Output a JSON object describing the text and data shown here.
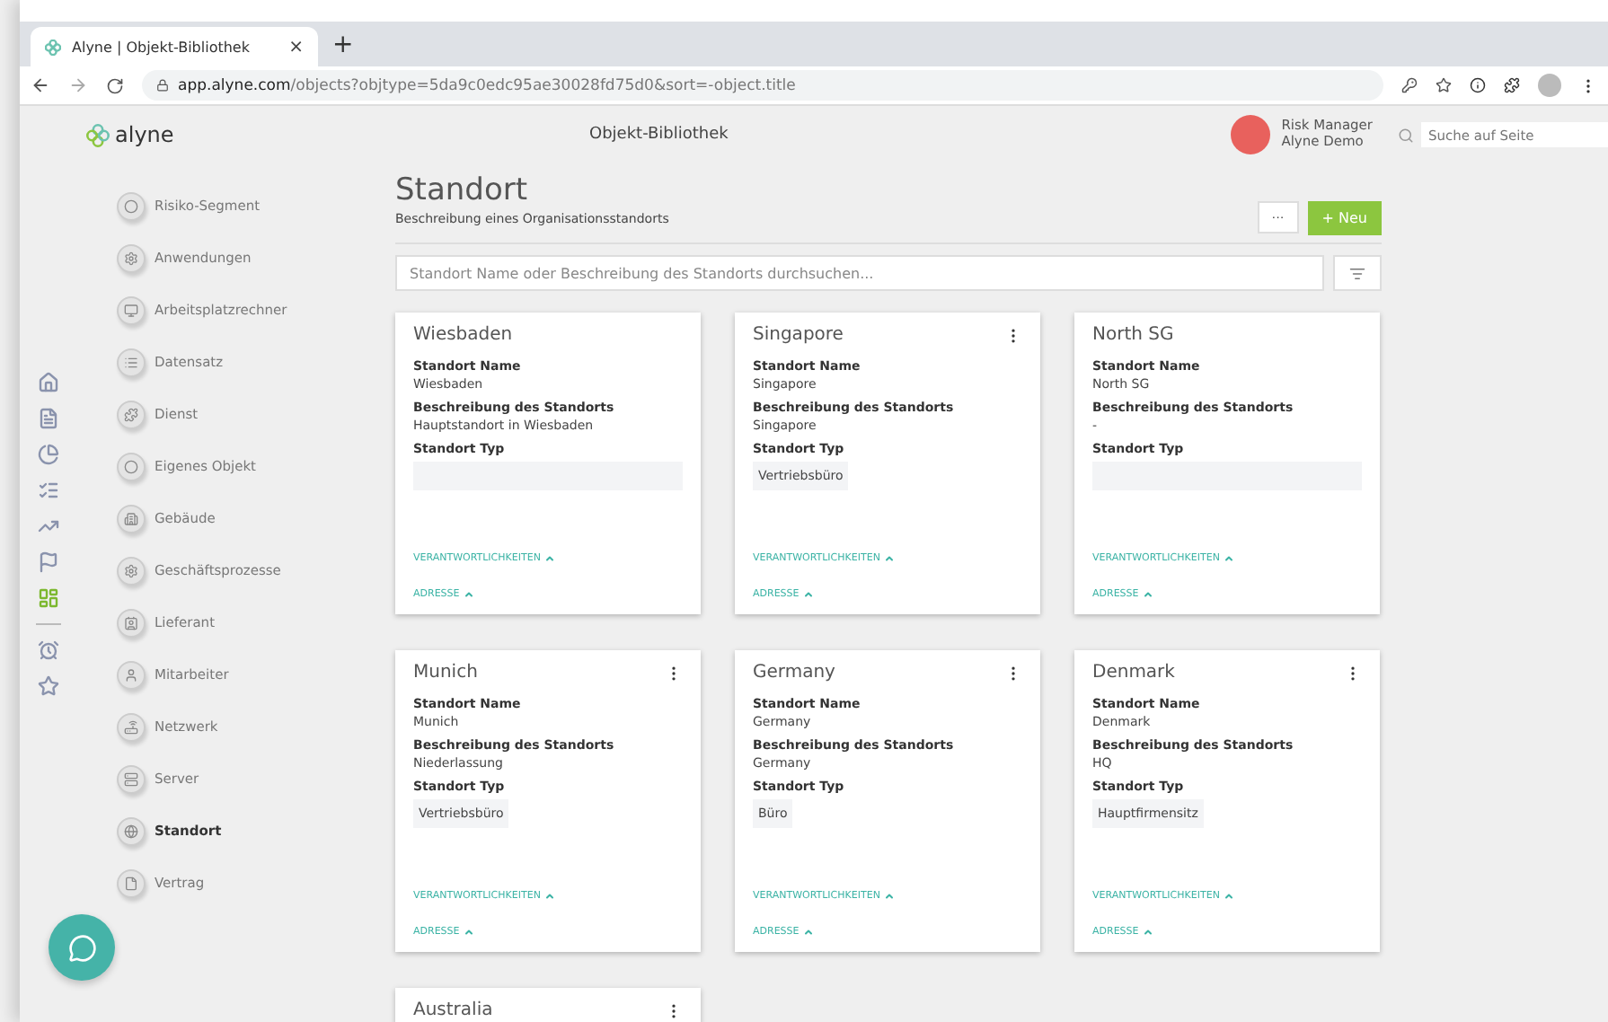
{
  "browser": {
    "tab_title": "Alyne | Objekt-Bibliothek",
    "tab_close": "×",
    "new_tab": "+",
    "url_host": "app.alyne.com",
    "url_path": "/objects?objtype=5da9c0edc95ae30028fd75d0&sort=-object.title"
  },
  "header": {
    "logo": "alyne",
    "title": "Objekt-Bibliothek",
    "user_role": "Risk Manager",
    "user_org": "Alyne Demo",
    "search_placeholder": "Suche auf Seite"
  },
  "rail": [
    {
      "kind": "home",
      "selected": false
    },
    {
      "kind": "document",
      "selected": false
    },
    {
      "kind": "pie",
      "selected": false
    },
    {
      "kind": "checklist",
      "selected": false
    },
    {
      "kind": "trend",
      "selected": false
    },
    {
      "kind": "flag",
      "selected": false
    },
    {
      "kind": "dashboard",
      "selected": true
    },
    {
      "kind": "alarm",
      "selected": false
    },
    {
      "kind": "star",
      "selected": false
    }
  ],
  "nav": [
    {
      "label": "Risiko-Segment",
      "kind": "circles",
      "selected": false
    },
    {
      "label": "Anwendungen",
      "kind": "gear",
      "selected": false
    },
    {
      "label": "Arbeitsplatzrechner",
      "kind": "monitor",
      "selected": false
    },
    {
      "label": "Datensatz",
      "kind": "list",
      "selected": false
    },
    {
      "label": "Dienst",
      "kind": "puzzle",
      "selected": false
    },
    {
      "label": "Eigenes Objekt",
      "kind": "circles",
      "selected": false
    },
    {
      "label": "Gebäude",
      "kind": "building",
      "selected": false
    },
    {
      "label": "Geschäftsprozesse",
      "kind": "gear",
      "selected": false
    },
    {
      "label": "Lieferant",
      "kind": "contact",
      "selected": false
    },
    {
      "label": "Mitarbeiter",
      "kind": "user",
      "selected": false
    },
    {
      "label": "Netzwerk",
      "kind": "router",
      "selected": false
    },
    {
      "label": "Server",
      "kind": "server",
      "selected": false
    },
    {
      "label": "Standort",
      "kind": "globe",
      "selected": true
    },
    {
      "label": "Vertrag",
      "kind": "file",
      "selected": false
    }
  ],
  "page": {
    "title": "Standort",
    "subtitle": "Beschreibung eines Organisationsstandorts",
    "more_button": "···",
    "new_button": "+ Neu",
    "search_placeholder": "Standort Name oder Beschreibung des Standorts durchsuchen..."
  },
  "cards": [
    {
      "title": "Wiesbaden",
      "menu": false,
      "fields": [
        {
          "label": "Standort Name",
          "value": "Wiesbaden"
        },
        {
          "label": "Beschreibung des Standorts",
          "value": "Hauptstandort in Wiesbaden"
        }
      ],
      "type_label": "Standort Typ",
      "links": [
        "VERANTWORTLICHKEITEN",
        "ADRESSE"
      ]
    },
    {
      "title": "Singapore",
      "menu": true,
      "fields": [
        {
          "label": "Standort Name",
          "value": "Singapore"
        },
        {
          "label": "Beschreibung des Standorts",
          "value": "Singapore"
        }
      ],
      "type_label": "Standort Typ",
      "type_value": "Vertriebsbüro",
      "links": [
        "VERANTWORTLICHKEITEN",
        "ADRESSE"
      ]
    },
    {
      "title": "North SG",
      "menu": false,
      "fields": [
        {
          "label": "Standort Name",
          "value": "North SG"
        },
        {
          "label": "Beschreibung des Standorts",
          "value": "-"
        }
      ],
      "type_label": "Standort Typ",
      "links": [
        "VERANTWORTLICHKEITEN",
        "ADRESSE"
      ]
    },
    {
      "title": "Munich",
      "menu": true,
      "fields": [
        {
          "label": "Standort Name",
          "value": "Munich"
        },
        {
          "label": "Beschreibung des Standorts",
          "value": "Niederlassung"
        }
      ],
      "type_label": "Standort Typ",
      "type_value": "Vertriebsbüro",
      "links": [
        "VERANTWORTLICHKEITEN",
        "ADRESSE"
      ]
    },
    {
      "title": "Germany",
      "menu": true,
      "fields": [
        {
          "label": "Standort Name",
          "value": "Germany"
        },
        {
          "label": "Beschreibung des Standorts",
          "value": "Germany"
        }
      ],
      "type_label": "Standort Typ",
      "type_value": "Büro",
      "links": [
        "VERANTWORTLICHKEITEN",
        "ADRESSE"
      ]
    },
    {
      "title": "Denmark",
      "menu": true,
      "fields": [
        {
          "label": "Standort Name",
          "value": "Denmark"
        },
        {
          "label": "Beschreibung des Standorts",
          "value": "HQ"
        }
      ],
      "type_label": "Standort Typ",
      "type_value": "Hauptfirmensitz",
      "links": [
        "VERANTWORTLICHKEITEN",
        "ADRESSE"
      ]
    },
    {
      "title": "Australia",
      "menu": true
    }
  ]
}
